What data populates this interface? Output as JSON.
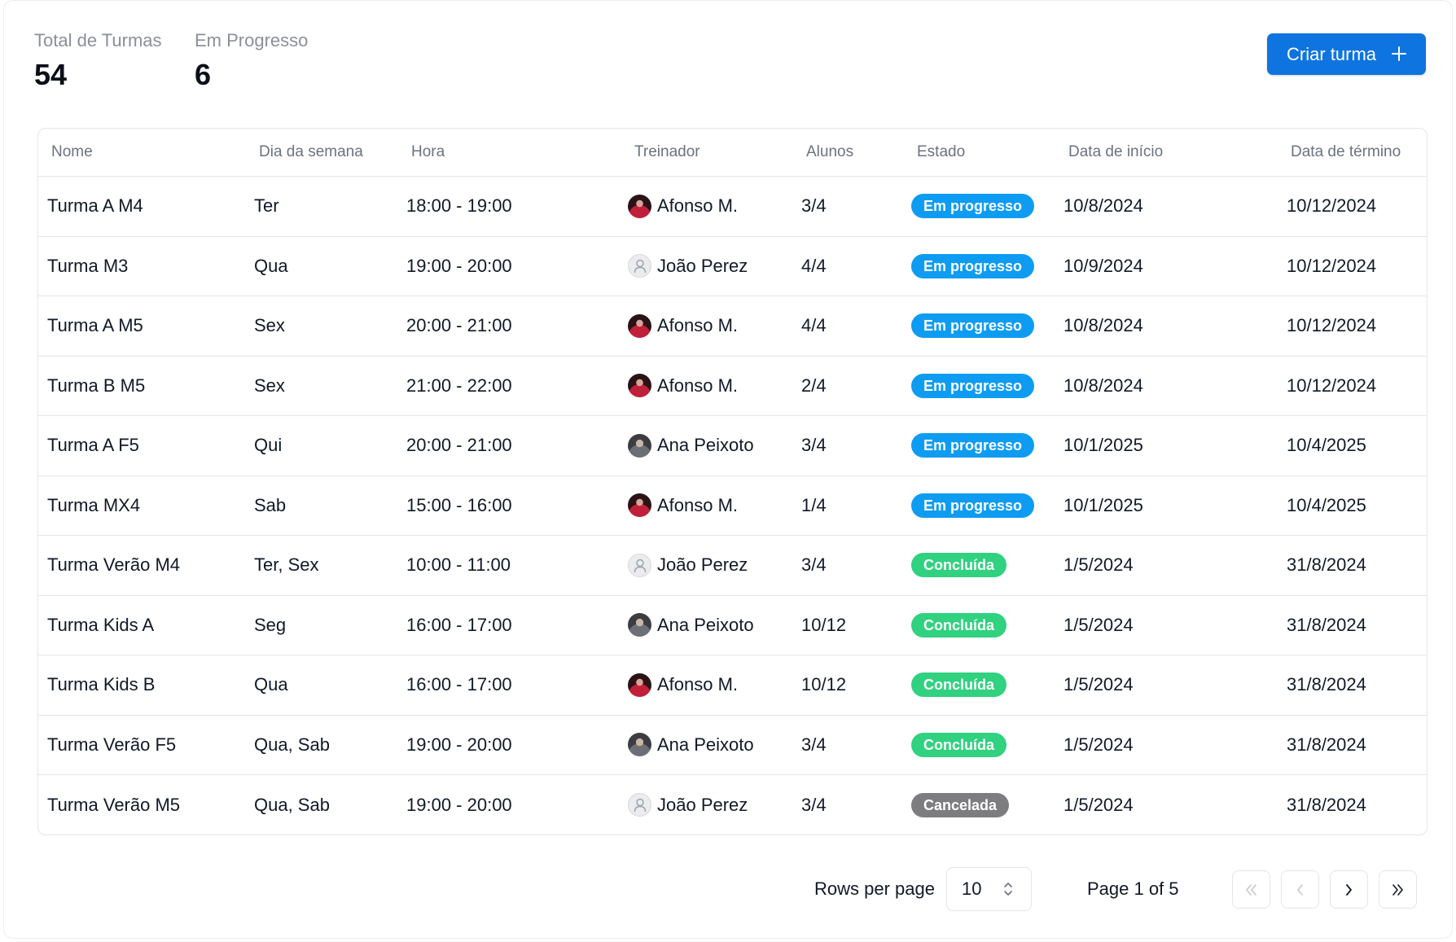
{
  "stats": [
    {
      "label": "Total de Turmas",
      "value": "54"
    },
    {
      "label": "Em Progresso",
      "value": "6"
    }
  ],
  "create_button": {
    "label": "Criar turma",
    "icon": "plus-icon"
  },
  "columns": [
    "Nome",
    "Dia da semana",
    "Hora",
    "Treinador",
    "Alunos",
    "Estado",
    "Data de início",
    "Data de término"
  ],
  "status_colors": {
    "Em progresso": "#0e9cf2",
    "Concluída": "#30d17f",
    "Cancelada": "#7d7d80"
  },
  "accent_color": "#0e74e0",
  "rows": [
    {
      "name": "Turma A M4",
      "day": "Ter",
      "time": "18:00 - 19:00",
      "trainer": "Afonso M.",
      "avatar": "afonso",
      "students": "3/4",
      "status": "Em progresso",
      "start": "10/8/2024",
      "end": "10/12/2024"
    },
    {
      "name": "Turma M3",
      "day": "Qua",
      "time": "19:00 - 20:00",
      "trainer": "João Perez",
      "avatar": "joao",
      "students": "4/4",
      "status": "Em progresso",
      "start": "10/9/2024",
      "end": "10/12/2024"
    },
    {
      "name": "Turma A M5",
      "day": "Sex",
      "time": "20:00 - 21:00",
      "trainer": "Afonso M.",
      "avatar": "afonso",
      "students": "4/4",
      "status": "Em progresso",
      "start": "10/8/2024",
      "end": "10/12/2024"
    },
    {
      "name": "Turma B M5",
      "day": "Sex",
      "time": "21:00 - 22:00",
      "trainer": "Afonso M.",
      "avatar": "afonso",
      "students": "2/4",
      "status": "Em progresso",
      "start": "10/8/2024",
      "end": "10/12/2024"
    },
    {
      "name": "Turma A F5",
      "day": "Qui",
      "time": "20:00 - 21:00",
      "trainer": "Ana Peixoto",
      "avatar": "ana",
      "students": "3/4",
      "status": "Em progresso",
      "start": "10/1/2025",
      "end": "10/4/2025"
    },
    {
      "name": "Turma MX4",
      "day": "Sab",
      "time": "15:00 - 16:00",
      "trainer": "Afonso M.",
      "avatar": "afonso",
      "students": "1/4",
      "status": "Em progresso",
      "start": "10/1/2025",
      "end": "10/4/2025"
    },
    {
      "name": "Turma Verão M4",
      "day": "Ter, Sex",
      "time": "10:00 - 11:00",
      "trainer": "João Perez",
      "avatar": "joao",
      "students": "3/4",
      "status": "Concluída",
      "start": "1/5/2024",
      "end": "31/8/2024"
    },
    {
      "name": "Turma Kids A",
      "day": "Seg",
      "time": "16:00 - 17:00",
      "trainer": "Ana Peixoto",
      "avatar": "ana",
      "students": "10/12",
      "status": "Concluída",
      "start": "1/5/2024",
      "end": "31/8/2024"
    },
    {
      "name": "Turma Kids B",
      "day": "Qua",
      "time": "16:00 - 17:00",
      "trainer": "Afonso M.",
      "avatar": "afonso",
      "students": "10/12",
      "status": "Concluída",
      "start": "1/5/2024",
      "end": "31/8/2024"
    },
    {
      "name": "Turma Verão F5",
      "day": "Qua, Sab",
      "time": "19:00 - 20:00",
      "trainer": "Ana Peixoto",
      "avatar": "ana",
      "students": "3/4",
      "status": "Concluída",
      "start": "1/5/2024",
      "end": "31/8/2024"
    },
    {
      "name": "Turma Verão M5",
      "day": "Qua, Sab",
      "time": "19:00 - 20:00",
      "trainer": "João Perez",
      "avatar": "joao",
      "students": "3/4",
      "status": "Cancelada",
      "start": "1/5/2024",
      "end": "31/8/2024"
    }
  ],
  "pagination": {
    "rows_per_page_label": "Rows per page",
    "rows_per_page_value": "10",
    "page_info": "Page 1 of 5",
    "buttons": [
      {
        "name": "first-page-button",
        "icon": "chevrons-left-icon",
        "enabled": false
      },
      {
        "name": "previous-page-button",
        "icon": "chevron-left-icon",
        "enabled": false
      },
      {
        "name": "next-page-button",
        "icon": "chevron-right-icon",
        "enabled": true
      },
      {
        "name": "last-page-button",
        "icon": "chevrons-right-icon",
        "enabled": true
      }
    ]
  }
}
